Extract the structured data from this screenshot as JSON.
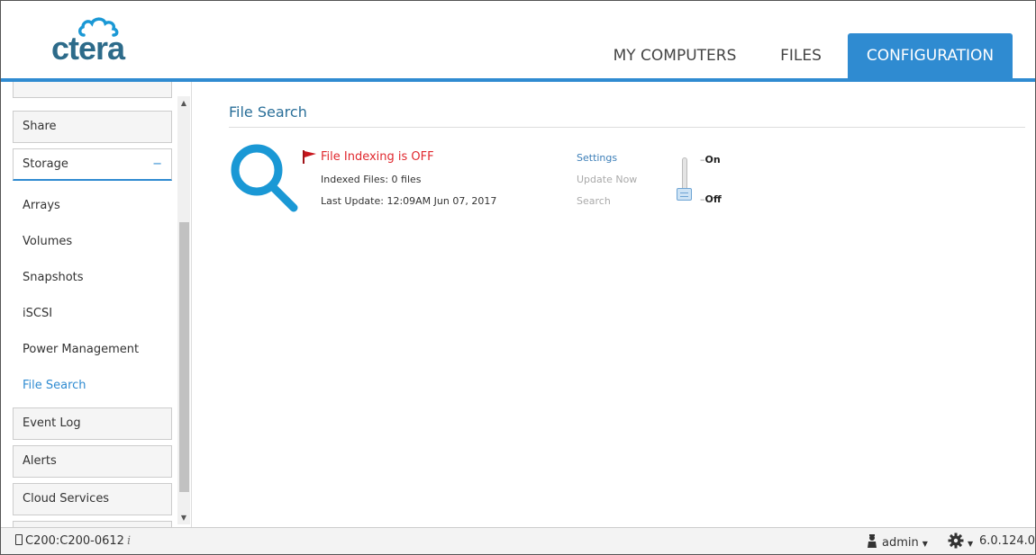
{
  "header": {
    "logo_text": "ctera",
    "tabs": [
      {
        "label": "MY COMPUTERS",
        "active": false
      },
      {
        "label": "FILES",
        "active": false
      },
      {
        "label": "CONFIGURATION",
        "active": true
      }
    ],
    "accent_color": "#2f8bd1"
  },
  "sidebar": {
    "share": "Share",
    "storage": "Storage",
    "storage_toggle": "−",
    "storage_items": [
      "Arrays",
      "Volumes",
      "Snapshots",
      "iSCSI",
      "Power Management",
      "File Search"
    ],
    "active_item": "File Search",
    "event_log": "Event Log",
    "alerts": "Alerts",
    "cloud_services": "Cloud Services"
  },
  "main": {
    "title": "File Search",
    "status": "File Indexing is OFF",
    "indexed_files": "Indexed Files: 0 files",
    "last_update": "Last Update: 12:09AM Jun 07, 2017",
    "actions": [
      {
        "label": "Settings",
        "enabled": true
      },
      {
        "label": "Update Now",
        "enabled": false
      },
      {
        "label": "Search",
        "enabled": false
      }
    ],
    "toggle": {
      "on_label": "On",
      "off_label": "Off",
      "tick": "–",
      "state": "off"
    },
    "icon": "magnifier-icon",
    "status_color": "#e0282e"
  },
  "footer": {
    "device": "C200:C200-0612",
    "info_mark": "i",
    "user": "admin",
    "version": "6.0.124.0"
  }
}
